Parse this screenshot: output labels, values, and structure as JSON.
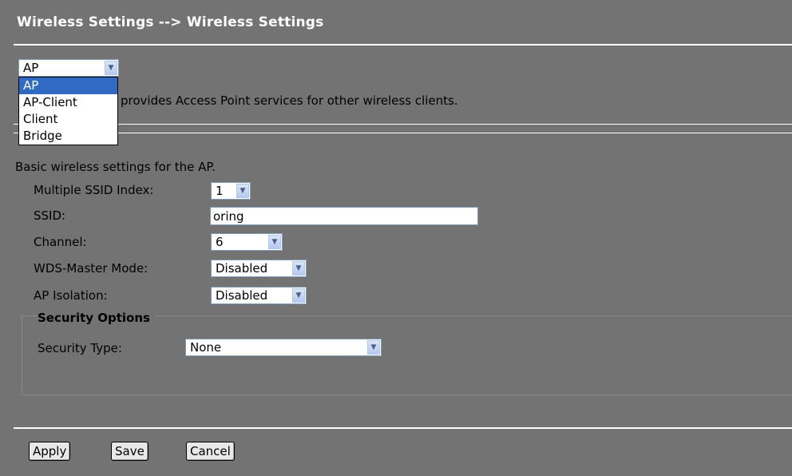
{
  "page": {
    "title": "Wireless Settings --> Wireless Settings"
  },
  "mode": {
    "selected": "AP",
    "options": [
      "AP",
      "AP-Client",
      "Client",
      "Bridge"
    ],
    "description": "provides Access Point services for other wireless clients."
  },
  "basic": {
    "intro": "Basic wireless settings for the AP.",
    "ssid_index_label": "Multiple SSID Index:",
    "ssid_index_value": "1",
    "ssid_label": "SSID:",
    "ssid_value": "oring",
    "channel_label": "Channel:",
    "channel_value": "6",
    "wds_label": "WDS-Master Mode:",
    "wds_value": "Disabled",
    "isolation_label": "AP Isolation:",
    "isolation_value": "Disabled"
  },
  "security": {
    "legend": "Security Options",
    "type_label": "Security Type:",
    "type_value": "None"
  },
  "buttons": {
    "apply": "Apply",
    "save": "Save",
    "cancel": "Cancel"
  },
  "colors": {
    "background": "#737373",
    "highlight": "#316ac5",
    "text_light": "#ffffff"
  }
}
